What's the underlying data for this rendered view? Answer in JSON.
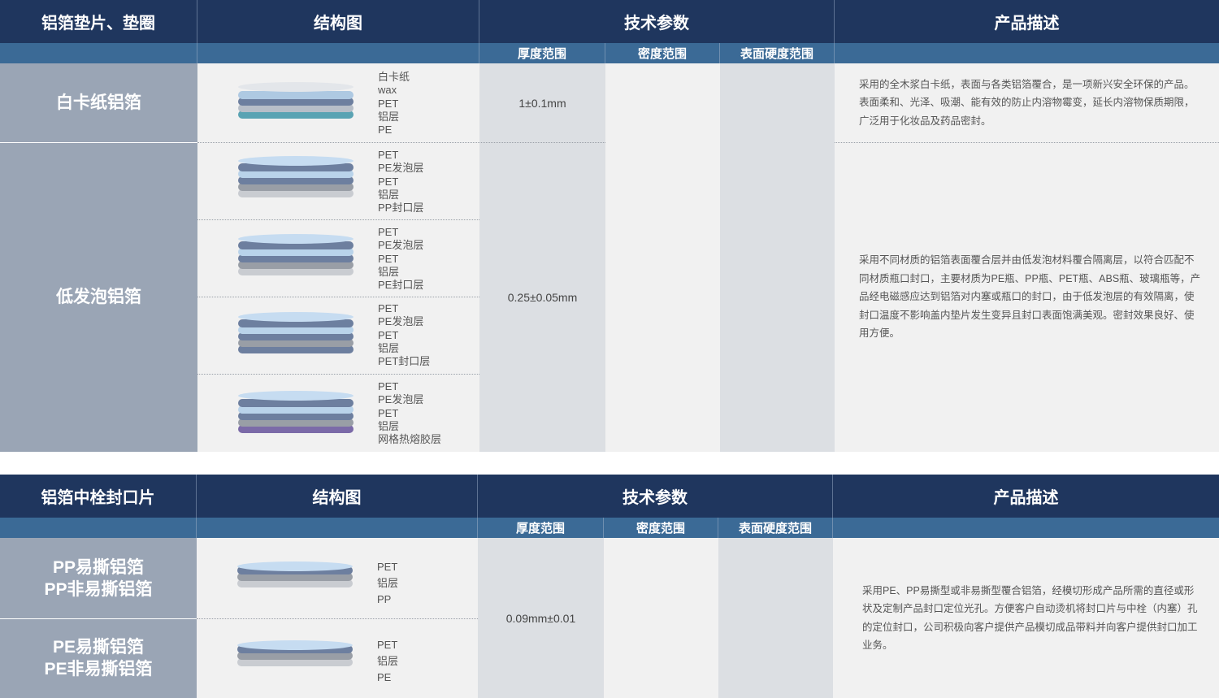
{
  "table1": {
    "headers": {
      "category": "铝箔垫片、垫圈",
      "structure": "结构图",
      "tech": "技术参数",
      "desc": "产品描述"
    },
    "subheaders": {
      "thickness": "厚度范围",
      "density": "密度范围",
      "hardness": "表面硬度范围"
    },
    "rows": [
      {
        "name": "白卡纸铝箔",
        "thickness": "1±0.1mm",
        "description": "采用的全木浆白卡纸，表面与各类铝箔覆合，是一项新兴安全环保的产品。表面柔和、光泽、吸潮、能有效的防止内溶物霉变，延长内溶物保质期限，广泛用于化妆品及药品密封。"
      },
      {
        "name": "低发泡铝箔",
        "thickness": "0.25±0.05mm",
        "description": "采用不同材质的铝箔表面覆合层并由低发泡材料覆合隔离层，以符合匹配不同材质瓶口封口，主要材质为PE瓶、PP瓶、PET瓶、ABS瓶、玻璃瓶等，产品经电磁感应达到铝箔对内塞或瓶口的封口，由于低发泡层的有效隔离，使封口温度不影响盖内垫片发生变异且封口表面饱满美观。密封效果良好、使用方便。"
      }
    ],
    "structures": [
      {
        "layers": [
          "白卡纸",
          "wax",
          "PET",
          "铝层",
          "PE"
        ]
      },
      {
        "layers": [
          "PET",
          "PE发泡层",
          "PET",
          "铝层",
          "PP封口层"
        ]
      },
      {
        "layers": [
          "PET",
          "PE发泡层",
          "PET",
          "铝层",
          "PE封口层"
        ]
      },
      {
        "layers": [
          "PET",
          "PE发泡层",
          "PET",
          "铝层",
          "PET封口层"
        ]
      },
      {
        "layers": [
          "PET",
          "PE发泡层",
          "PET",
          "铝层",
          "网格热熔胶层"
        ]
      }
    ]
  },
  "table2": {
    "headers": {
      "category": "铝箔中栓封口片",
      "structure": "结构图",
      "tech": "技术参数",
      "desc": "产品描述"
    },
    "subheaders": {
      "thickness": "厚度范围",
      "density": "密度范围",
      "hardness": "表面硬度范围"
    },
    "rows": [
      {
        "name1": "PP易撕铝箔",
        "name2": "PP非易撕铝箔"
      },
      {
        "name1": "PE易撕铝箔",
        "name2": "PE非易撕铝箔"
      }
    ],
    "thickness": "0.09mm±0.01",
    "description": "采用PE、PP易撕型或非易撕型覆合铝箔，经模切形成产品所需的直径或形状及定制产品封口定位光孔。方便客户自动烫机将封口片与中栓（内塞）孔的定位封口，公司积极向客户提供产品模切成品带料并向客户提供封口加工业务。",
    "structures": [
      {
        "layers": [
          "PET",
          "铝层",
          "PP"
        ]
      },
      {
        "layers": [
          "PET",
          "铝层",
          "PE"
        ]
      }
    ]
  },
  "colors": {
    "header": "#1f365e",
    "subheader": "#3b6a96",
    "row_label": "#9aa5b5",
    "light_cell": "#f1f1f1",
    "grey_cell": "#dcdfe3"
  }
}
